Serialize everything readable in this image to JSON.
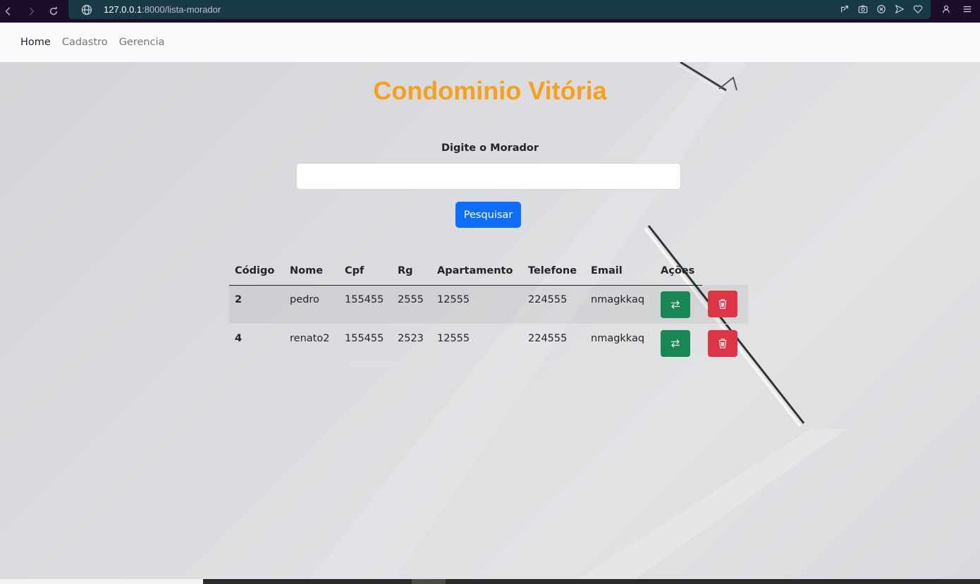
{
  "browser": {
    "url_host": "127.0.0.1",
    "url_rest": ":8000/lista-morador"
  },
  "navbar": {
    "items": [
      {
        "label": "Home",
        "active": true
      },
      {
        "label": "Cadastro",
        "active": false
      },
      {
        "label": "Gerencia",
        "active": false
      }
    ]
  },
  "page": {
    "title": "Condominio Vitória",
    "search_label": "Digite o Morador",
    "search_value": "",
    "search_button": "Pesquisar"
  },
  "table": {
    "headers": [
      "Código",
      "Nome",
      "Cpf",
      "Rg",
      "Apartamento",
      "Telefone",
      "Email",
      "Ações"
    ],
    "rows": [
      {
        "codigo": "2",
        "nome": "pedro",
        "cpf": "155455",
        "rg": "2555",
        "apartamento": "12555",
        "telefone": "224555",
        "email": "nmagkkaq"
      },
      {
        "codigo": "4",
        "nome": "renato2",
        "cpf": "155455",
        "rg": "2523",
        "apartamento": "12555",
        "telefone": "224555",
        "email": "nmagkkaq"
      }
    ]
  },
  "colors": {
    "title": "#f7a01a",
    "primary": "#0d6efd",
    "success": "#198754",
    "danger": "#dc3545"
  },
  "icons": {
    "edit_action": "arrow-left-right-icon",
    "delete_action": "trash-icon"
  }
}
